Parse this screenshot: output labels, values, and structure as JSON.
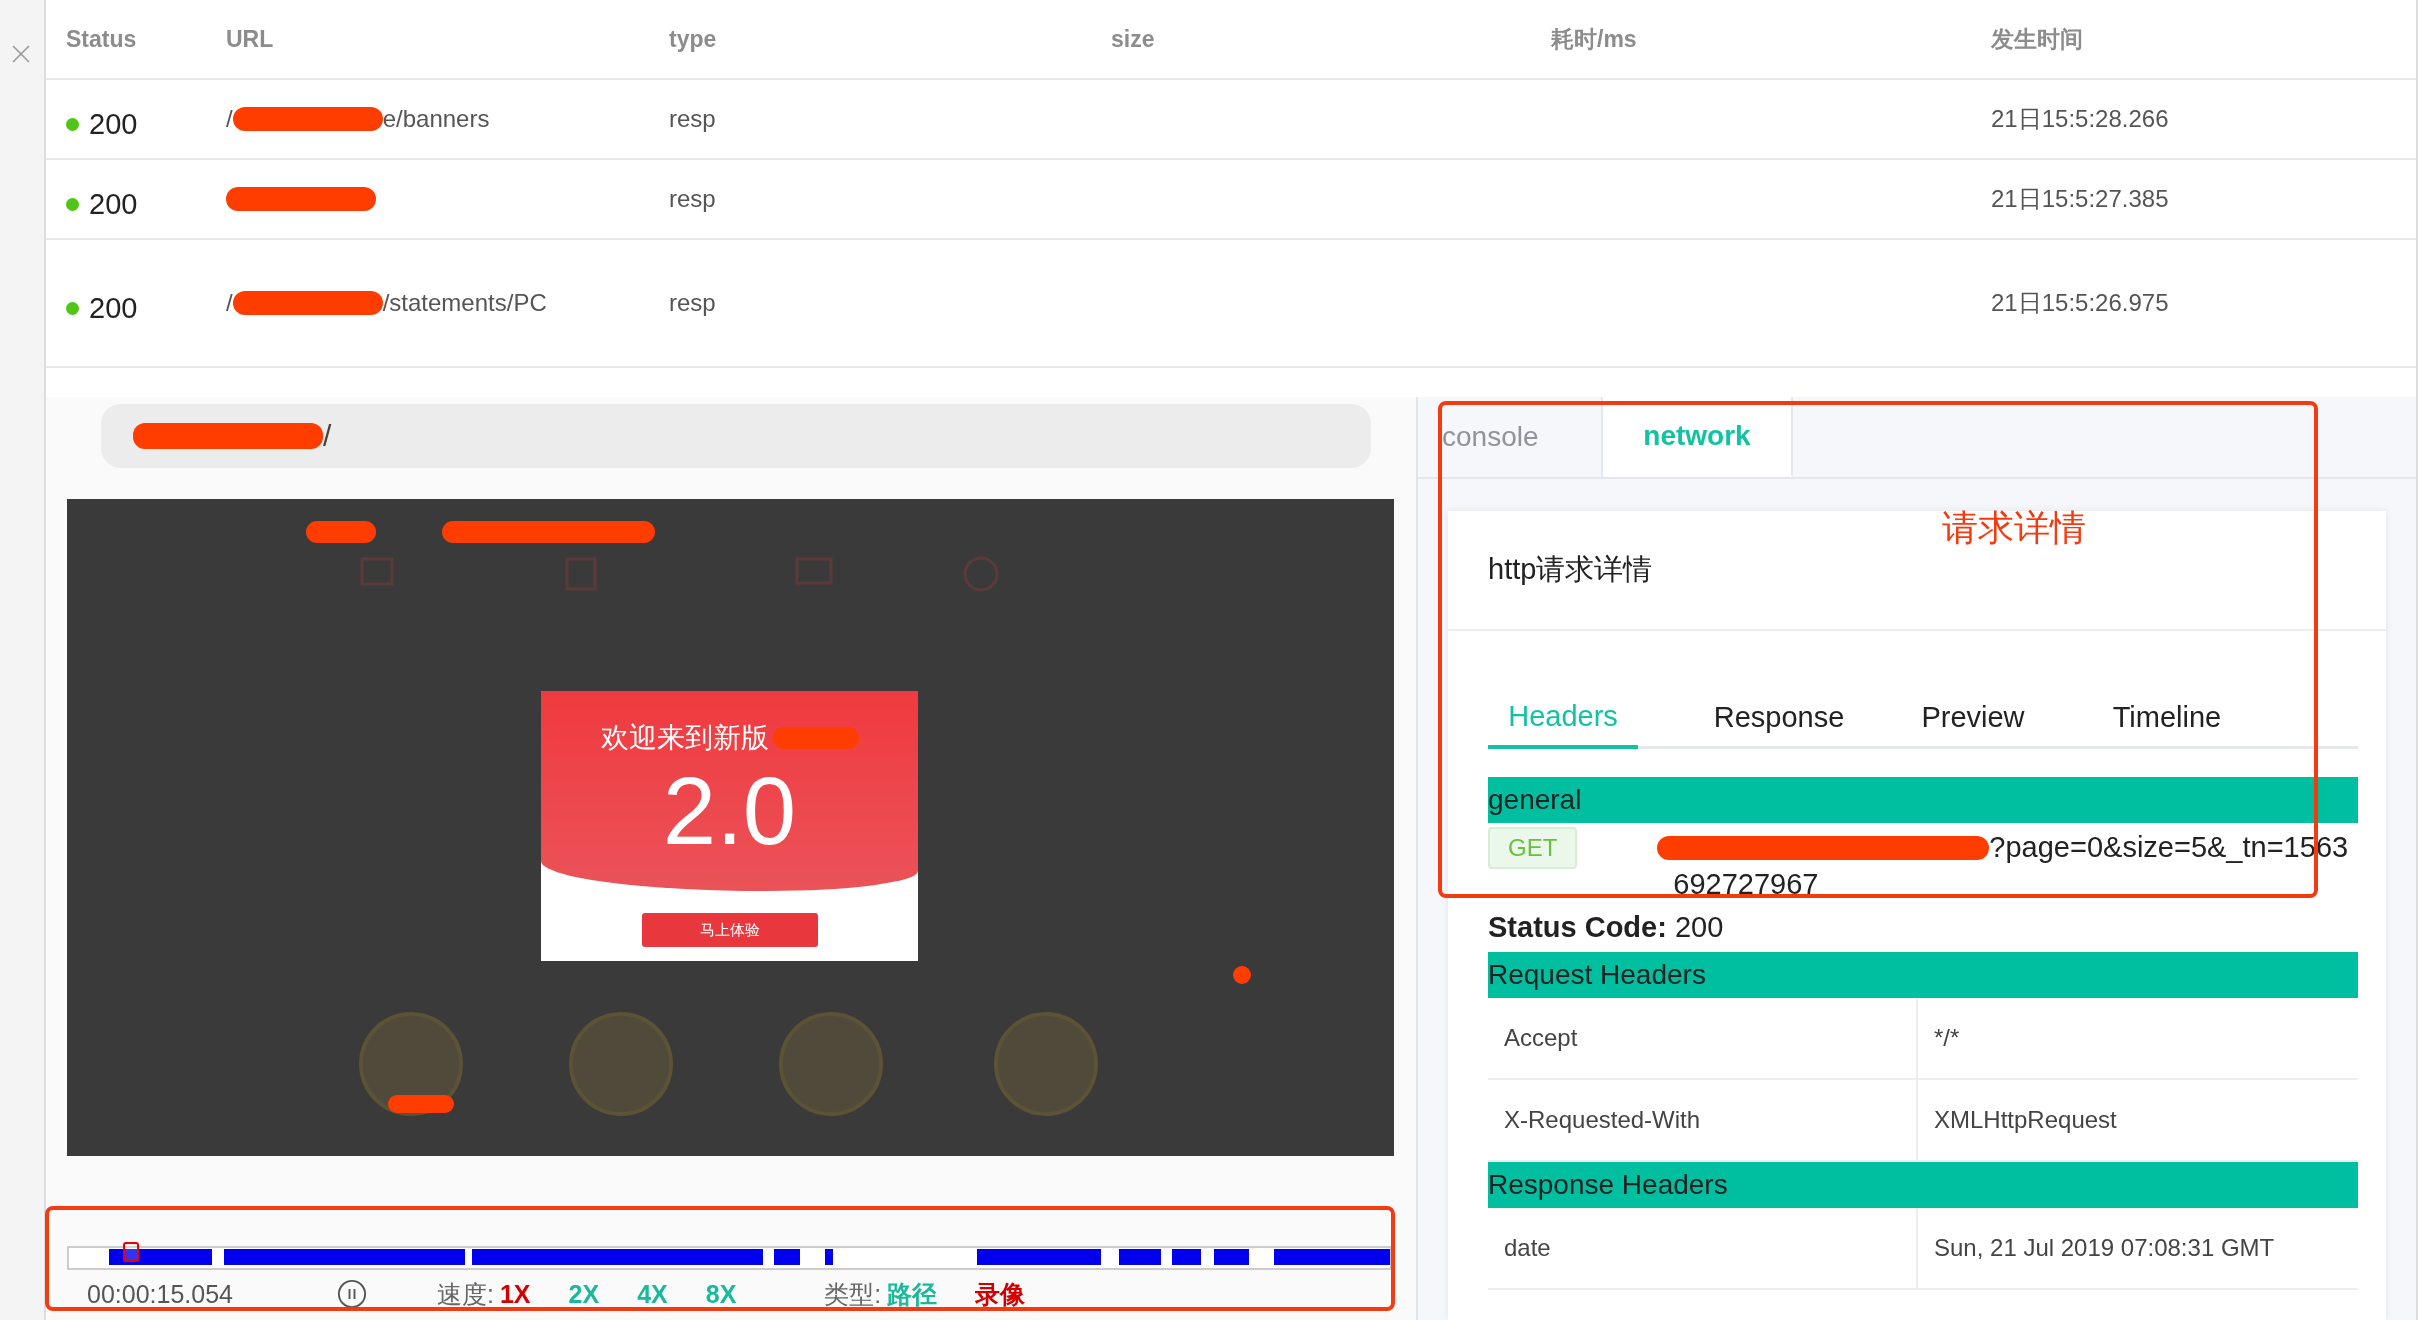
{
  "table": {
    "columns": [
      "Status",
      "URL",
      "type",
      "size",
      "耗时/ms",
      "发生时间"
    ],
    "rows": [
      {
        "status": "200",
        "url_before": "/",
        "url_redacted": true,
        "url_after": "e/banners",
        "type": "resp",
        "time": "21日15:5:28.266"
      },
      {
        "status": "200",
        "url_before": "",
        "url_redacted": true,
        "url_after": "",
        "type": "resp",
        "time": "21日15:5:27.385"
      },
      {
        "status": "200",
        "url_before": "/",
        "url_redacted": true,
        "url_after": "/statements/PC",
        "type": "resp",
        "time": "21日15:5:26.975"
      }
    ]
  },
  "replay": {
    "address": {
      "redacted": true,
      "after": "/"
    },
    "popup": {
      "title": "欢迎来到新版",
      "version": "2.0",
      "button": "马上体验"
    },
    "timeline": {
      "level": 0.047,
      "time": "00:00:15.054",
      "speed_label": "速度:",
      "speeds": [
        {
          "label": "1X",
          "selected": true
        },
        {
          "label": "2X",
          "selected": false
        },
        {
          "label": "4X",
          "selected": false
        },
        {
          "label": "8X",
          "selected": false
        }
      ],
      "type_label": "类型:",
      "types": [
        {
          "label": "路径",
          "selected": false
        },
        {
          "label": "录像",
          "selected": true
        }
      ]
    }
  },
  "devtools": {
    "tabs": [
      {
        "label": "console",
        "selected": false
      },
      {
        "label": "network",
        "selected": true
      }
    ],
    "annotation": "请求详情",
    "title": "http请求详情",
    "subtabs": [
      {
        "label": "Headers",
        "selected": true
      },
      {
        "label": "Response",
        "selected": false
      },
      {
        "label": "Preview",
        "selected": false
      },
      {
        "label": "Timeline",
        "selected": false
      }
    ],
    "general": "general",
    "method": "GET",
    "url_after": "?page=0&size=5&_tn=1563",
    "url_line2": "692727967",
    "status_label": "Status Code:",
    "status_value": "200",
    "sections": [
      {
        "title": "Request Headers",
        "rows": [
          {
            "name": "Accept",
            "value": "*/*"
          },
          {
            "name": "X-Requested-With",
            "value": "XMLHttpRequest"
          }
        ]
      },
      {
        "title": "Response Headers",
        "rows": [
          {
            "name": "date",
            "value": "Sun, 21 Jul 2019 07:08:31 GMT"
          }
        ]
      }
    ]
  }
}
